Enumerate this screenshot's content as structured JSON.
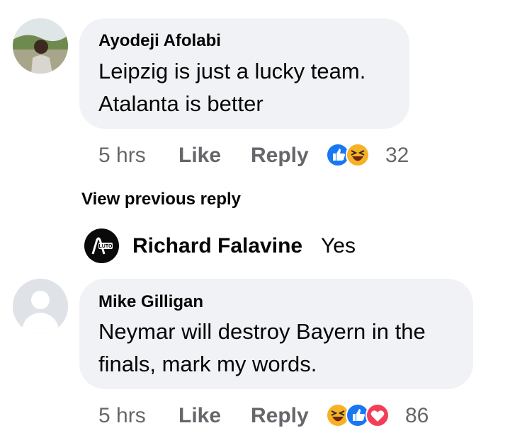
{
  "comments": [
    {
      "author": "Ayodeji Afolabi",
      "line1": "Leipzig is just a lucky team.",
      "line2": "Atalanta is better",
      "time": "5 hrs",
      "like_label": "Like",
      "reply_label": "Reply",
      "reactions": [
        "like-icon",
        "haha-icon"
      ],
      "reaction_count": "32"
    },
    {
      "author": "Mike Gilligan",
      "line1": "Neymar will destroy Bayern in the",
      "line2": "finals, mark my words.",
      "time": "5 hrs",
      "like_label": "Like",
      "reply_label": "Reply",
      "reactions": [
        "haha-icon",
        "like-icon",
        "love-icon"
      ],
      "reaction_count": "86"
    }
  ],
  "view_previous": "View previous reply",
  "reply": {
    "author": "Richard Falavine",
    "text": "Yes",
    "avatar_text": "LUTO"
  },
  "colors": {
    "bubble": "#f0f2f5",
    "meta": "#65676b",
    "like_blue": "#1877f2",
    "haha_yellow": "#f7b125",
    "love_red": "#f33e58"
  }
}
